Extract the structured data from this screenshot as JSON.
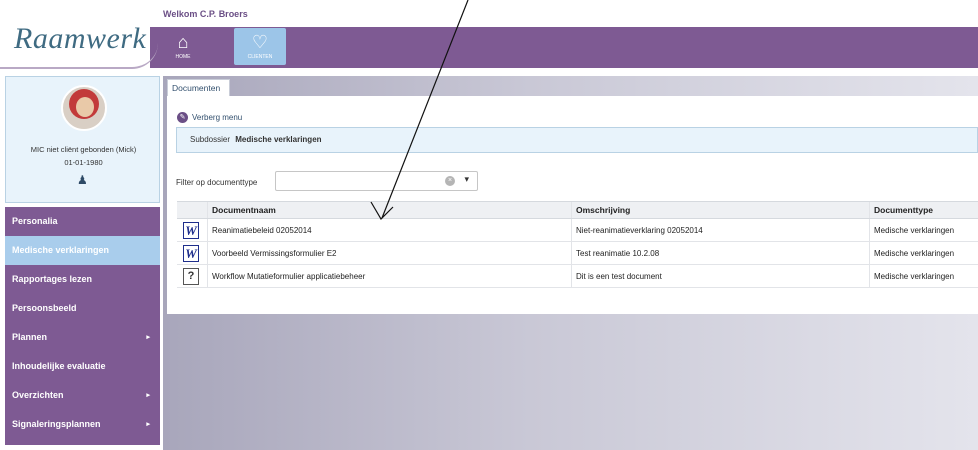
{
  "header": {
    "logo": "Raamwerk",
    "welcome": "Welkom C.P. Broers",
    "nav": [
      {
        "label": "HOME",
        "icon": "home-icon"
      },
      {
        "label": "CLIENTEN",
        "icon": "heart-plus-icon"
      }
    ]
  },
  "profile": {
    "name": "MIC niet cliënt gebonden (Mick)",
    "dob": "01-01-1980",
    "icon": "person-icon"
  },
  "sidebar": {
    "items": [
      {
        "label": "Personalia",
        "has_submenu": false
      },
      {
        "label": "Medische verklaringen",
        "has_submenu": false,
        "active": true
      },
      {
        "label": "Rapportages lezen",
        "has_submenu": false
      },
      {
        "label": "Persoonsbeeld",
        "has_submenu": false
      },
      {
        "label": "Plannen",
        "has_submenu": true
      },
      {
        "label": "Inhoudelijke evaluatie",
        "has_submenu": false
      },
      {
        "label": "Overzichten",
        "has_submenu": true
      },
      {
        "label": "Signaleringsplannen",
        "has_submenu": true
      }
    ]
  },
  "main": {
    "tab": "Documenten",
    "toggle_menu": "Verberg menu",
    "subdossier_label": "Subdossier",
    "subdossier_value": "Medische verklaringen",
    "filter_label": "Filter op documenttype",
    "filter_value": "",
    "table": {
      "headers": [
        "Documentnaam",
        "Omschrijving",
        "Documenttype"
      ],
      "rows": [
        {
          "icon": "word-document-icon",
          "name": "Reanimatiebeleid 02052014",
          "desc": "Niet-reanimatieverklaring 02052014",
          "type": "Medische verklaringen"
        },
        {
          "icon": "word-document-icon",
          "name": "Voorbeeld Vermissingsformulier E2",
          "desc": "Test reanimatie 10.2.08",
          "type": "Medische verklaringen"
        },
        {
          "icon": "unknown-document-icon",
          "name": "Workflow Mutatieformulier applicatiebeheer",
          "desc": "Dit is een test document",
          "type": "Medische verklaringen"
        }
      ]
    }
  },
  "colors": {
    "brand_purple": "#7e5a93",
    "active_blue": "#a9cdec",
    "panel_blue": "#e8f3fb"
  }
}
